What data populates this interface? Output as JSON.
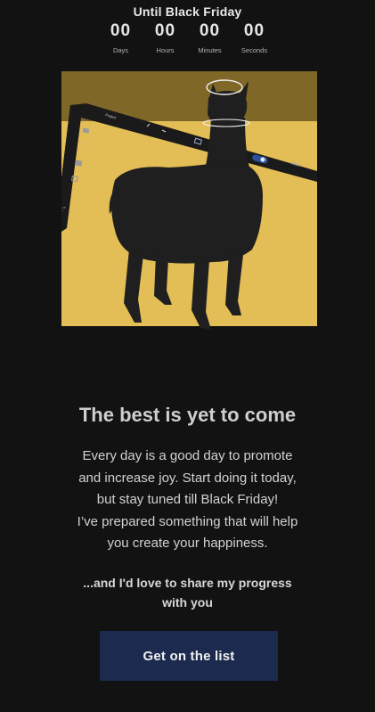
{
  "countdown": {
    "title": "Until Black Friday",
    "units": [
      {
        "value": "00",
        "label": "Days"
      },
      {
        "value": "00",
        "label": "Hours"
      },
      {
        "value": "00",
        "label": "Minutes"
      },
      {
        "value": "00",
        "label": "Seconds"
      }
    ]
  },
  "hero": {
    "mock_ui": {
      "project_label": "Project",
      "main_label": "Main"
    },
    "colors": {
      "background_yellow": "#e3bd55",
      "top_band": "#7e6727",
      "llama": "#1f1f1f"
    }
  },
  "content": {
    "headline": "The best is yet to come",
    "body_lines": [
      "Every day is a good day to promote",
      "and increase joy. Start doing it today,",
      "but stay tuned till Black Friday!",
      "I’ve prepared something that will help",
      "you create your happiness."
    ],
    "subtext_lines": [
      "...and I'd love to share my progress",
      "with you"
    ],
    "cta_label": "Get on the list"
  },
  "colors": {
    "page_background": "#121212",
    "cta_background": "#1b2a4e"
  }
}
